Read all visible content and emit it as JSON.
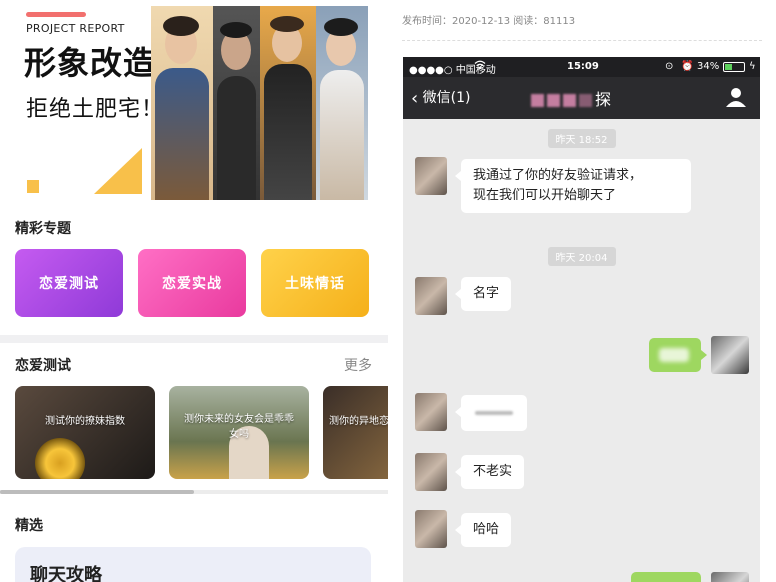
{
  "banner": {
    "eyebrow": "PROJECT REPORT",
    "title": "形象改造",
    "subtitle": "拒绝土肥宅！"
  },
  "topics": {
    "title": "精彩专题",
    "items": [
      {
        "label": "恋爱测试",
        "color": "#a848e6"
      },
      {
        "label": "恋爱实战",
        "color": "#f24fb2"
      },
      {
        "label": "土味情话",
        "color": "#f8bd24"
      }
    ]
  },
  "tests": {
    "title": "恋爱测试",
    "more": "更多",
    "cards": [
      {
        "text": "测试你的撩妹指数"
      },
      {
        "text": "测你未来的女友会是乖乖女吗"
      },
      {
        "text": "测你的异地恋"
      }
    ]
  },
  "featured": {
    "title": "精选",
    "card_title": "聊天攻略"
  },
  "article": {
    "meta": "发布时间：2020-12-13 阅读：81113"
  },
  "phone": {
    "status": {
      "carrier": "●●●●○ 中国移动",
      "time": "15:09",
      "battery": "34%"
    },
    "nav": {
      "back": "微信(1)",
      "title_suffix": "探"
    },
    "chips": [
      "昨天 18:52",
      "昨天 20:04"
    ],
    "messages": [
      {
        "text": "我通过了你的好友验证请求，\n现在我们可以开始聊天了"
      },
      {
        "text": "名字"
      },
      {
        "text": "不老实"
      },
      {
        "text": "哈哈"
      }
    ]
  }
}
